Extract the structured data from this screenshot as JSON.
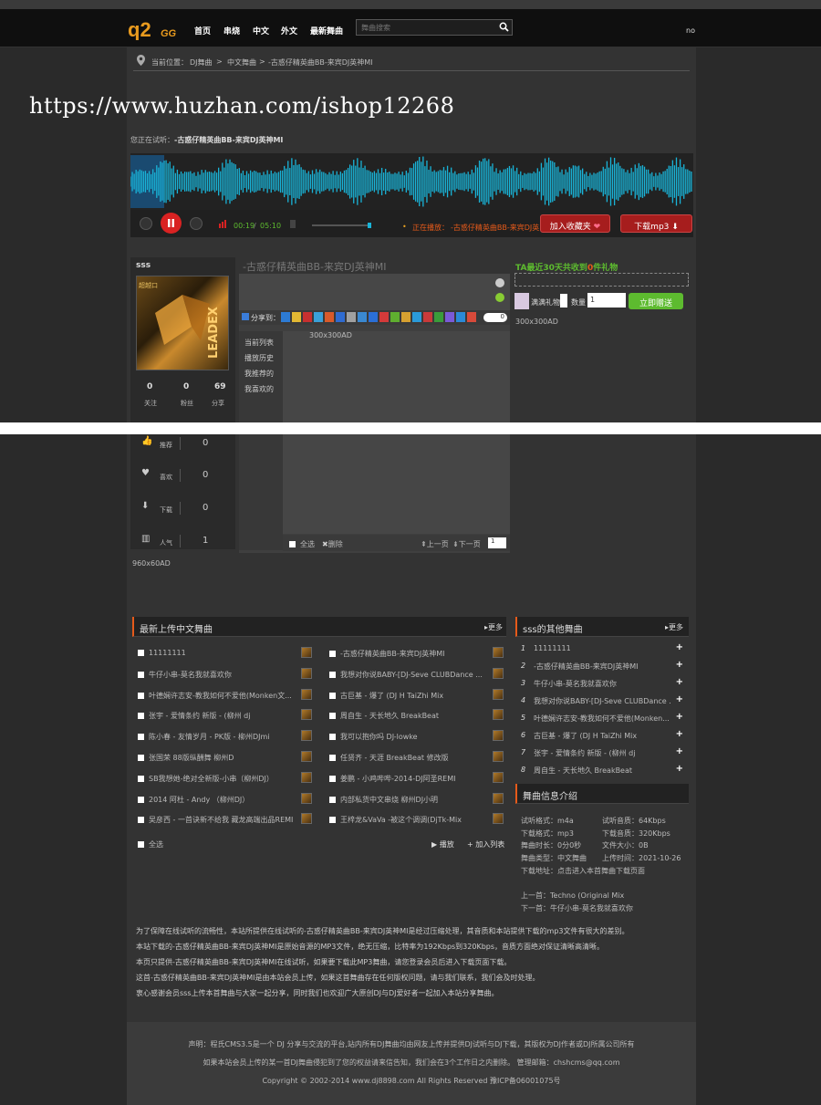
{
  "header": {
    "no": "no",
    "nav": [
      "首页",
      "串烧",
      "中文",
      "外文",
      "最新舞曲"
    ],
    "search_placeholder": "舞曲搜索"
  },
  "breadcrumb": {
    "prefix": "当前位置：",
    "items": [
      "DJ舞曲",
      "中文舞曲",
      "-古惑仔精英曲BB-来宾DJ英神MI"
    ],
    "sep": ">"
  },
  "watermark": "https://www.huzhan.com/ishop12268",
  "player": {
    "now_label": "您正在试听：",
    "now_title": "-古惑仔精英曲BB-来宾DJ英神MI",
    "current": "00:19",
    "total": "05:10",
    "progress": 0.06,
    "playing_label": "正在播放：",
    "playing_title": "-古惑仔精英曲BB-来宾DJ英",
    "fav_button": "加入收藏夹",
    "download_button": "下载mp3"
  },
  "user": {
    "name": "sss",
    "stats": [
      {
        "value": "0",
        "label": "关注"
      },
      {
        "value": "0",
        "label": "粉丝"
      },
      {
        "value": "69",
        "label": "分享"
      }
    ],
    "metrics": [
      {
        "icon": "thumbs-up-icon",
        "label": "推荐",
        "value": "0"
      },
      {
        "icon": "heart-icon",
        "label": "喜欢",
        "value": "0"
      },
      {
        "icon": "download-icon",
        "label": "下载",
        "value": "0"
      },
      {
        "icon": "bar-chart-icon",
        "label": "人气",
        "value": "1"
      }
    ]
  },
  "track_title": "-古惑仔精英曲BB-来宾DJ英神MI",
  "share": {
    "label": "分享到：",
    "count": "0"
  },
  "list_tabs": [
    "当前列表",
    "播放历史",
    "我推荐的",
    "我喜欢的"
  ],
  "ad_300": "300x300AD",
  "list_footer": {
    "select_all": "全选",
    "delete": "删除",
    "prev": "上一页",
    "next": "下一页",
    "page": "1"
  },
  "ad_960": "960x60AD",
  "gift": {
    "title_a": "TA最近30天共收到",
    "count": "0",
    "title_b": "件礼物",
    "gift_name": "满满礼物",
    "qty_label": "数量",
    "qty": "1",
    "send": "立即赠送",
    "ad": "300x300AD"
  },
  "latest": {
    "title": "最新上传中文舞曲",
    "more": "更多",
    "left": [
      "11111111",
      "牛仔小串-莫名我就喜欢你",
      "叶德娴许志安-教我如何不爱他(Monken文...",
      "张宇 - 爱情条约 新版 - (柳州 dj",
      "陈小春 - 友情岁月 - PK版 - 柳州DJmi",
      "张国荣 88版纵酬舞 柳州D",
      "SB我想她-绝对全新版-小串（柳州DJ）",
      "2014 阿杜 - Andy （柳州DJ）",
      "吴彦西 - 一首诀新不给我 藏龙高端出品REMI"
    ],
    "right": [
      "-古惑仔精英曲BB-来宾DJ英神MI",
      "我想对你说BABY-[DJ-Seve CLUBDance ...",
      "古巨基 - 爆了 (DJ H TaiZhi Mix",
      "周自生 - 天长地久 BreakBeat",
      "我可以抱你吗 DJ-lowke",
      "任贤齐 - 天涯 BreakBeat 修改版",
      "姜鹏 - 小鸡哔哔-2014-DJ阿圣REMI",
      "内部私货中文串烧 柳州DJ小明",
      "王梓龙&VaVa -被这个调调(DjTk-Mix"
    ],
    "select_all": "全选",
    "play": "播放",
    "add_list": "加入列表"
  },
  "others": {
    "title": "sss的其他舞曲",
    "more": "更多",
    "items": [
      {
        "n": "1",
        "t": "11111111"
      },
      {
        "n": "2",
        "t": "-古惑仔精英曲BB-来宾DJ英神MI"
      },
      {
        "n": "3",
        "t": "牛仔小串-莫名我就喜欢你"
      },
      {
        "n": "4",
        "t": "我想对你说BABY-[DJ-Seve CLUBDance ..."
      },
      {
        "n": "5",
        "t": "叶德娴许志安-教我如何不爱他(Monken..."
      },
      {
        "n": "6",
        "t": "古巨基 - 爆了 (DJ H TaiZhi Mix"
      },
      {
        "n": "7",
        "t": "张宇 - 爱情条约 新版 - (柳州 dj"
      },
      {
        "n": "8",
        "t": "周自生 - 天长地久 BreakBeat"
      }
    ]
  },
  "info": {
    "title": "舞曲信息介绍",
    "rows": [
      [
        "试听格式：m4a",
        "试听音质：64Kbps"
      ],
      [
        "下载格式：mp3",
        "下载音质：320Kbps"
      ],
      [
        "舞曲时长：0分0秒",
        "文件大小：0B"
      ],
      [
        "舞曲类型：中文舞曲",
        "上传时间：2021-10-26"
      ]
    ],
    "download_link": "下载地址：点击进入本首舞曲下载页面",
    "prev": "上一首：Techno (Original Mix",
    "next": "下一首：牛仔小串-莫名我就喜欢你"
  },
  "description": [
    "为了保障在线试听的流畅性，本站所提供在线试听的-古惑仔精英曲BB-来宾DJ英神MI是经过压缩处理，其音质和本站提供下载的mp3文件有很大的差别。",
    "本站下载的-古惑仔精英曲BB-来宾DJ英神MI是原始音源的MP3文件，绝无压缩，比特率为192Kbps到320Kbps，音质方面绝对保证清晰高清晰。",
    "本页只提供-古惑仔精英曲BB-来宾DJ英神MI在线试听，如果要下载此MP3舞曲，请您登录会员后进入下载页面下载。",
    "这首-古惑仔精英曲BB-来宾DJ英神MI是由本站会员上传，如果这首舞曲存在任何版权问题，请与我们联系，我们会及时处理。",
    "衷心感谢会员sss上传本首舞曲与大家一起分享，同时我们也欢迎广大原创DJ与DJ爱好者一起加入本站分享舞曲。"
  ],
  "footer": [
    "声明：程氏CMS3.5是一个 DJ 分享与交流的平台,站内所有DJ舞曲均由网友上传并提供DJ试听与DJ下载，其版权为DJ作者或DJ所属公司所有",
    "如果本站会员上传的某一首DJ舞曲侵犯到了您的权益请来信告知，我们会在3个工作日之内删除。 管理邮箱：chshcms@qq.com",
    "Copyright © 2002-2014 www.dj8898.com All Rights Reserved 豫ICP备06001075号"
  ],
  "colors": {
    "accent": "#e65a1a",
    "green": "#5dbb2f",
    "wave": "#19b4d8",
    "red": "#c81e1e"
  }
}
